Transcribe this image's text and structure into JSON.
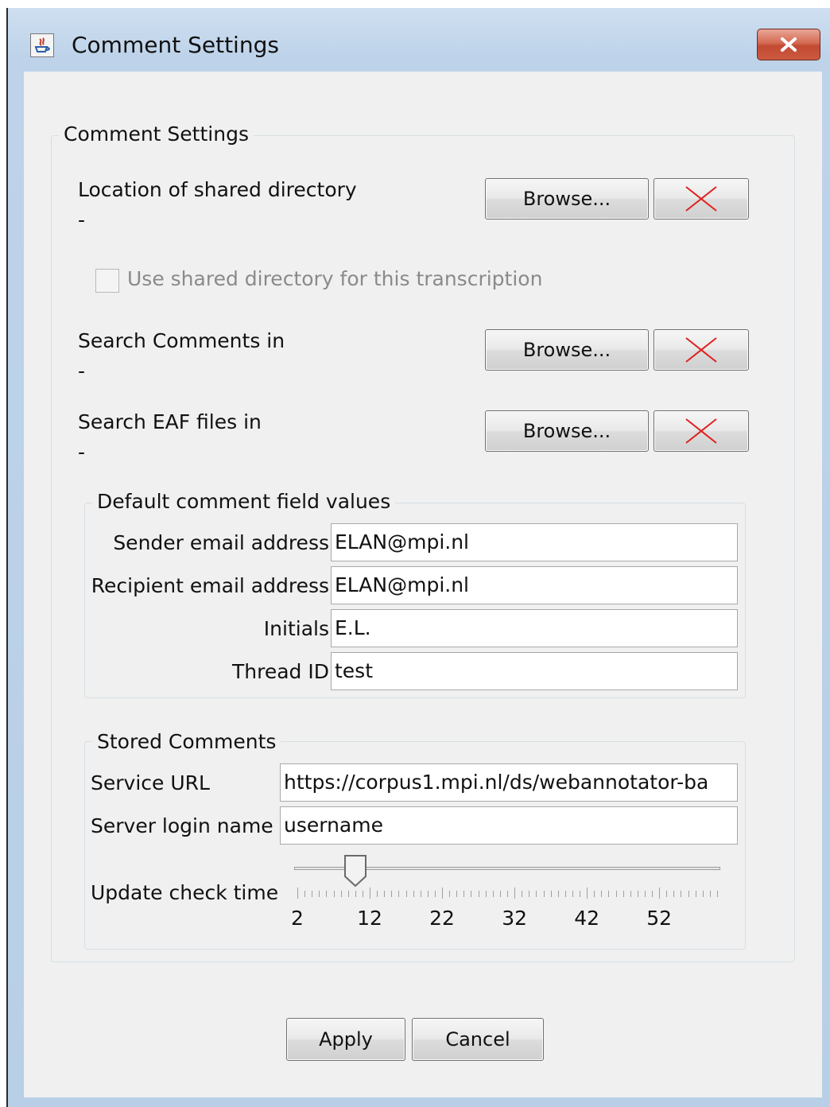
{
  "window": {
    "title": "Comment Settings"
  },
  "settings_group": {
    "title": "Comment Settings",
    "shared_directory": {
      "label": "Location of shared directory",
      "value": "-"
    },
    "use_shared_checkbox": {
      "label": "Use shared directory for this transcription",
      "checked": false,
      "enabled": false
    },
    "search_comments": {
      "label": "Search Comments in",
      "value": "-"
    },
    "search_eaf": {
      "label": "Search EAF files in",
      "value": "-"
    },
    "browse_label": "Browse..."
  },
  "defaults_group": {
    "title": "Default comment field values",
    "sender": {
      "label": "Sender email address",
      "value": "ELAN@mpi.nl"
    },
    "recipient": {
      "label": "Recipient email address",
      "value": "ELAN@mpi.nl"
    },
    "initials": {
      "label": "Initials",
      "value": "E.L."
    },
    "thread": {
      "label": "Thread ID",
      "value": "test"
    }
  },
  "stored_group": {
    "title": "Stored Comments",
    "service_url": {
      "label": "Service URL",
      "value": "https://corpus1.mpi.nl/ds/webannotator-ba"
    },
    "login": {
      "label": "Server login name",
      "value": "username"
    },
    "update_check": {
      "label": "Update check time",
      "min": 2,
      "max": 60,
      "value": 10,
      "tick_labels": [
        "2",
        "12",
        "22",
        "32",
        "42",
        "52"
      ]
    }
  },
  "buttons": {
    "apply": "Apply",
    "cancel": "Cancel"
  }
}
